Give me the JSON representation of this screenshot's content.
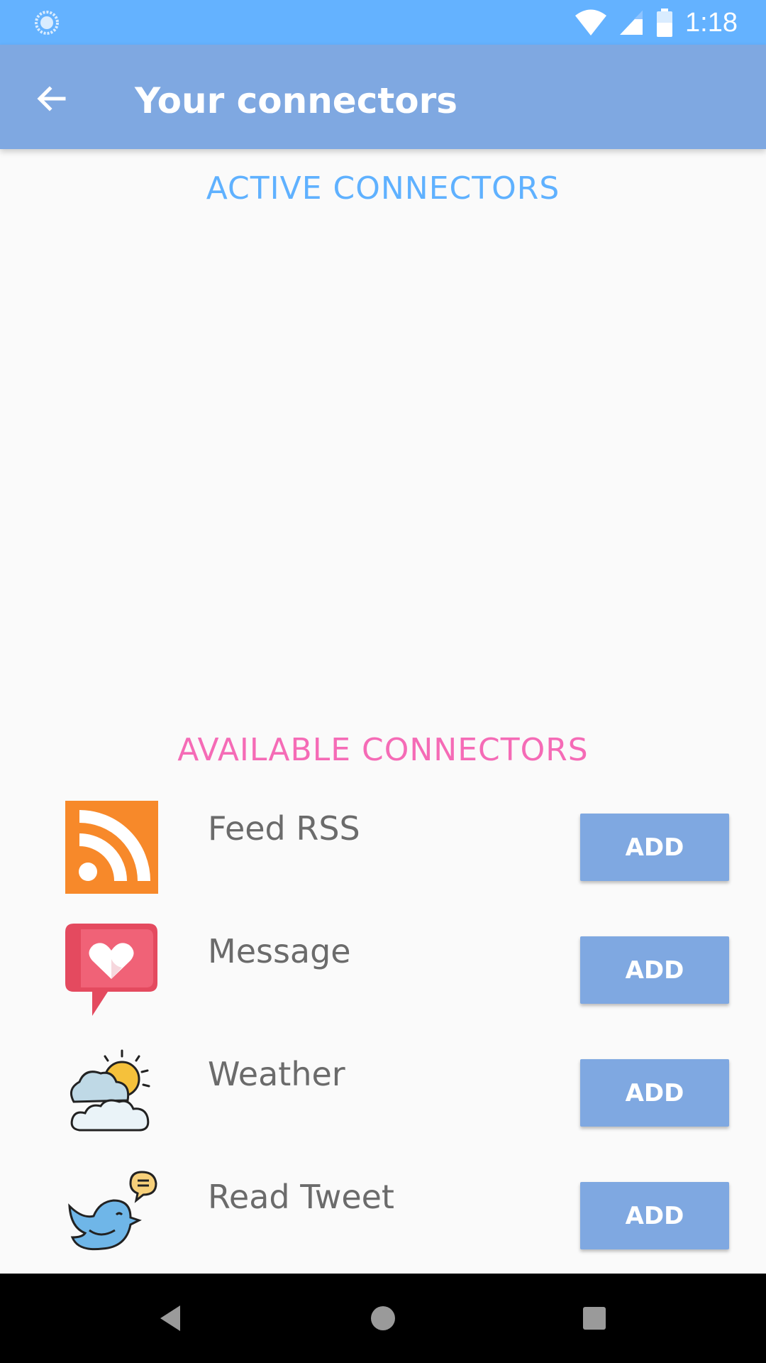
{
  "status_bar": {
    "time": "1:18",
    "icons": [
      "sync-icon",
      "wifi-icon",
      "signal-icon",
      "battery-icon"
    ]
  },
  "app_bar": {
    "title": "Your connectors",
    "back_icon": "arrow-back-icon"
  },
  "sections": {
    "active_title": "ACTIVE CONNECTORS",
    "available_title": "AVAILABLE CONNECTORS"
  },
  "connectors": [
    {
      "label": "Feed RSS",
      "button": "ADD",
      "icon": "rss-icon"
    },
    {
      "label": "Message",
      "button": "ADD",
      "icon": "heart-message-icon"
    },
    {
      "label": "Weather",
      "button": "ADD",
      "icon": "weather-icon"
    },
    {
      "label": "Read Tweet",
      "button": "ADD",
      "icon": "bird-tweet-icon"
    }
  ],
  "nav_bar": {
    "icons": [
      "nav-back-icon",
      "nav-home-icon",
      "nav-recents-icon"
    ]
  },
  "colors": {
    "status_bar": "#64B2FF",
    "app_bar": "#7FA8E1",
    "active_title": "#5FB1FF",
    "available_title": "#F56BB6",
    "button": "#7FA8E1"
  }
}
